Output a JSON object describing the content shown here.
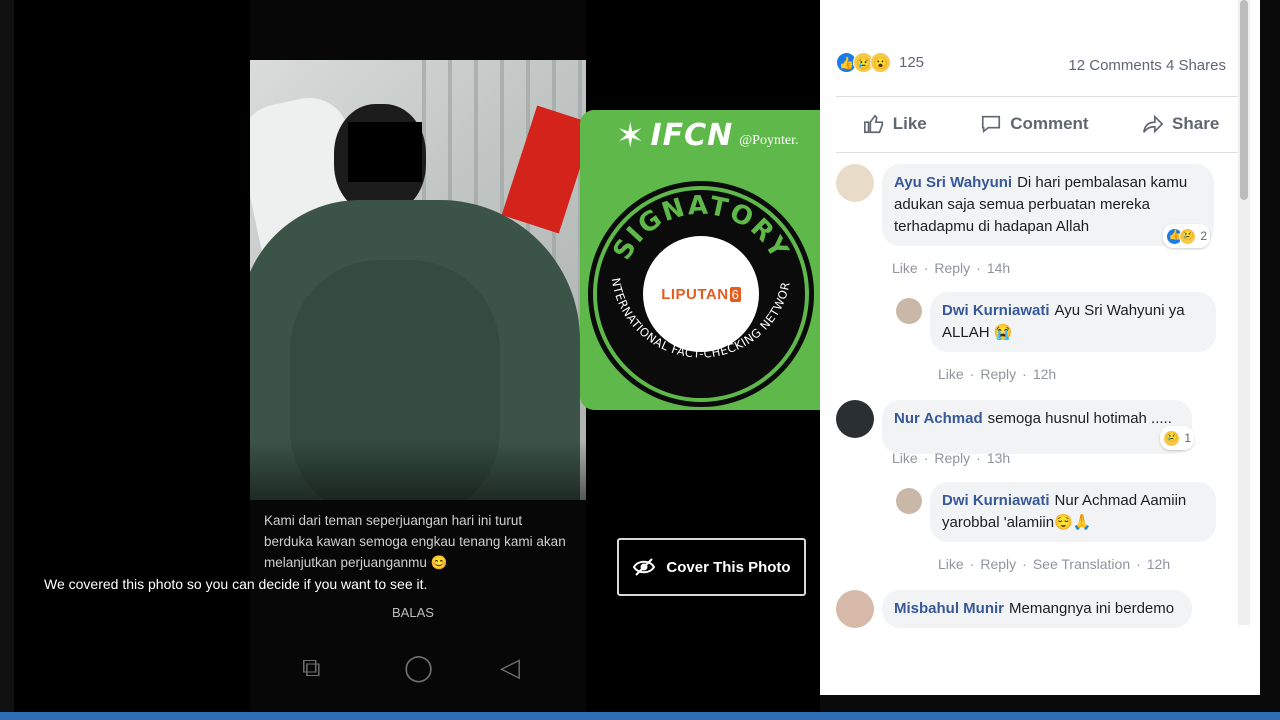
{
  "viewer": {
    "caption": "Kami dari teman seperjuangan hari ini turut berduka kawan semoga engkau tenang kami akan melanjutkan perjuanganmu 😊",
    "cover_note": "We covered this photo so you can decide if you want to see it.",
    "balas": "BALAS",
    "cover_button": "Cover This Photo"
  },
  "badge": {
    "org": "IFCN",
    "partner": "@Poynter.",
    "seal_top": "SIGNATORY",
    "seal_bottom": "INTERNATIONAL FACT-CHECKING NETWORK",
    "logo_text": "LIPUTAN",
    "logo_number": "6",
    "accent": "#5fb84a"
  },
  "post": {
    "reaction_count": "125",
    "comments": "12 Comments",
    "shares": "4 Shares",
    "actions": {
      "like": "Like",
      "comment": "Comment",
      "share": "Share"
    }
  },
  "comments": [
    {
      "author": "Ayu Sri Wahyuni",
      "text": "Di hari pembalasan kamu adukan saja semua perbuatan mereka terhadapmu di hadapan Allah",
      "like": "Like",
      "reply": "Reply",
      "time": "14h",
      "reactions": "2"
    },
    {
      "author": "Dwi Kurniawati",
      "text": "Ayu Sri Wahyuni ya ALLAH 😭",
      "like": "Like",
      "reply": "Reply",
      "time": "12h"
    },
    {
      "author": "Nur Achmad",
      "text": "semoga husnul hotimah .....",
      "like": "Like",
      "reply": "Reply",
      "time": "13h",
      "reactions": "1"
    },
    {
      "author": "Dwi Kurniawati",
      "text": "Nur Achmad Aamiin yarobbal 'alamiin😌🙏",
      "like": "Like",
      "reply": "Reply",
      "see_translation": "See Translation",
      "time": "12h"
    },
    {
      "author": "Misbahul Munir",
      "text": "Memangnya ini berdemo"
    }
  ],
  "colors": {
    "fb_blue": "#385898",
    "like_blue": "#1a7ce9",
    "bar_blue": "#2f6db5"
  }
}
